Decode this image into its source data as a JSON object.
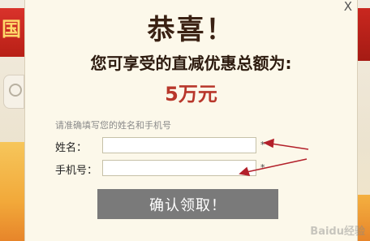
{
  "dialog": {
    "close_label": "X",
    "title": "恭喜！",
    "subtitle": "您可享受的直减优惠总额为:",
    "amount": "5万元",
    "hint": "请准确填写您的姓名和手机号",
    "fields": {
      "name_label": "姓名：",
      "name_value": "",
      "phone_label": "手机号：",
      "phone_value": "",
      "required_mark": "*"
    },
    "submit_label": "确认领取！"
  },
  "background": {
    "left_banner_glyph": "国"
  },
  "watermark": "Baidu经验",
  "colors": {
    "title": "#3a2113",
    "amount": "#b8372b",
    "button": "#7a7a7a",
    "annotation_arrow": "#b3202a",
    "modal_bg": "#fcf8ea"
  }
}
